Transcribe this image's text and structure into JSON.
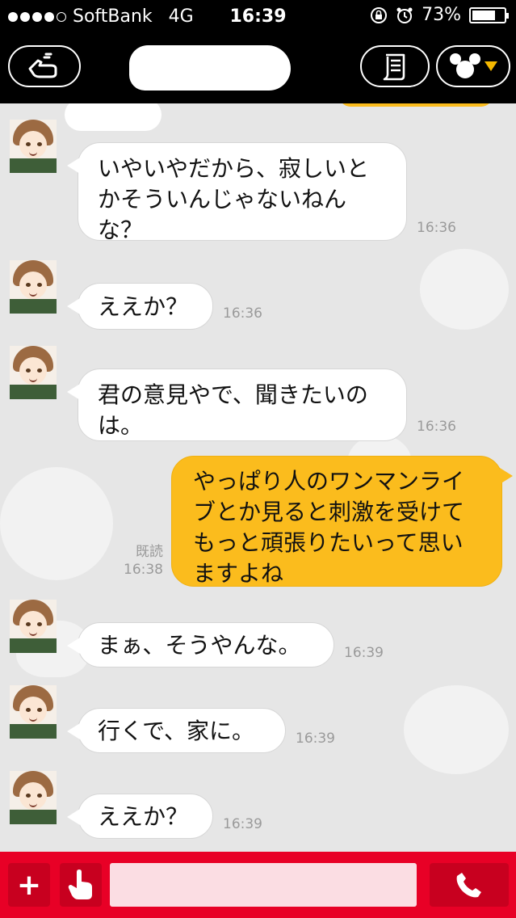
{
  "status_bar": {
    "carrier": "SoftBank",
    "network": "4G",
    "time": "16:39",
    "battery_percent": "73%",
    "battery_level": 0.73,
    "signal_bars_filled": 4,
    "signal_bars_total": 5
  },
  "nav": {
    "back_icon": "hand-back-icon",
    "notes_icon": "scroll-note-icon",
    "theme_icon": "mickey-head-icon",
    "dropdown_color": "#f5b800"
  },
  "messages": [
    {
      "side": "in",
      "text": "いやいやだから、寂しいとかそういんじゃないねんな？",
      "time": "16:36"
    },
    {
      "side": "in",
      "text": "ええか？",
      "time": "16:36"
    },
    {
      "side": "in",
      "text": "君の意見やで、聞きたいのは。",
      "time": "16:36"
    },
    {
      "side": "out",
      "text": "やっぱり人のワンマンライブとか見ると刺激を受けてもっと頑張りたいって思いますよね",
      "time": "16:38",
      "read_label": "既読"
    },
    {
      "side": "in",
      "text": "まぁ、そうやんな。",
      "time": "16:39"
    },
    {
      "side": "in",
      "text": "行くで、家に。",
      "time": "16:39"
    },
    {
      "side": "in",
      "text": "ええか？",
      "time": "16:39"
    }
  ],
  "input_bar": {
    "plus_label": "+",
    "plus_icon": "plus-icon",
    "sticker_icon": "hand-pointer-icon",
    "call_icon": "phone-icon",
    "input_value": "",
    "accent_color": "#e80026",
    "input_bg": "#fbdde3"
  },
  "colors": {
    "incoming_bubble": "#ffffff",
    "outgoing_bubble": "#fbbc1d",
    "timestamp": "#9a9a9a"
  }
}
